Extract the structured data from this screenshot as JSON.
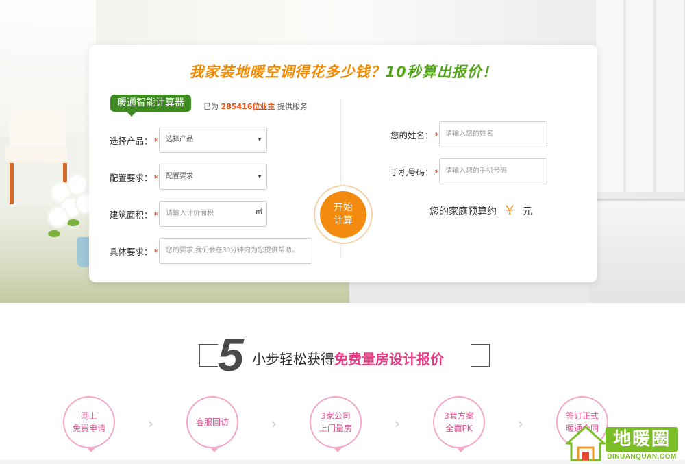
{
  "headline": {
    "part_a": "我家装地暖空调得花多少钱？",
    "part_b": "10秒算出报价",
    "part_c": "！"
  },
  "calculator": {
    "badge": "暖通智能计算器",
    "served_prefix": "已为",
    "served_count": "285416位业主",
    "served_suffix": "提供服务"
  },
  "form_left": {
    "product": {
      "label": "选择产品：",
      "required": "*",
      "value": "选择产品"
    },
    "config": {
      "label": "配置要求：",
      "required": "*",
      "value": "配置要求"
    },
    "area": {
      "label": "建筑面积：",
      "required": "*",
      "placeholder": "请输入计价面积",
      "unit": "㎡"
    },
    "detail": {
      "label": "具体要求：",
      "required": "*",
      "placeholder": "您的要求,我们会在30分钟内为您提供帮助。"
    }
  },
  "start_button": {
    "line1": "开始",
    "line2": "计算"
  },
  "form_right": {
    "name": {
      "label": "您的姓名：",
      "required": "*",
      "placeholder": "请输入您的姓名"
    },
    "phone": {
      "label": "手机号码：",
      "required": "*",
      "placeholder": "请输入您的手机号码"
    },
    "budget": {
      "label": "您的家庭预算约",
      "symbol": "￥",
      "unit": "元"
    }
  },
  "steps_section": {
    "number": "5",
    "text_plain": "小步轻松获得",
    "text_highlight": "免费量房设计报价",
    "steps": [
      {
        "line1": "网上",
        "line2": "免费申请"
      },
      {
        "line1": "客服回访",
        "line2": ""
      },
      {
        "line1": "3家公司",
        "line2": "上门量房"
      },
      {
        "line1": "3套方案",
        "line2": "全面PK"
      },
      {
        "line1": "签订正式",
        "line2": "暖通合同"
      }
    ],
    "arrow": "›"
  },
  "watermark": {
    "word": "地暖圈",
    "url": "DINUANQUAN.COM"
  },
  "colors": {
    "orange": "#f18a0f",
    "green": "#3e8c22",
    "pink": "#e93a85",
    "required": "#e74b0e"
  }
}
